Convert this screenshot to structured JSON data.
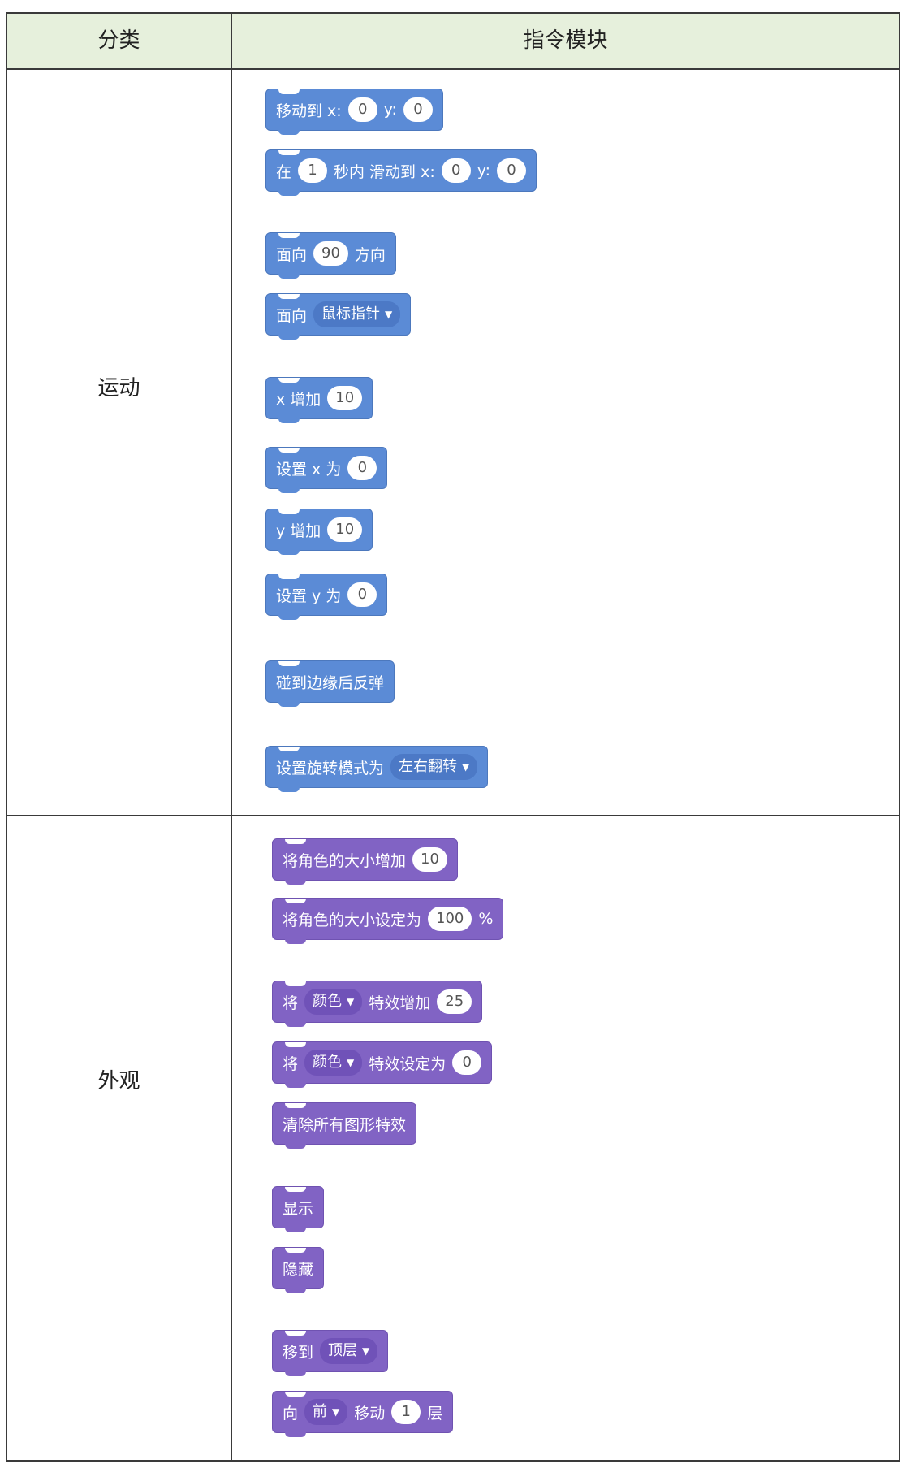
{
  "header": {
    "col1": "分类",
    "col2": "指令模块"
  },
  "categories": {
    "motion": "运动",
    "looks": "外观"
  },
  "blocks": {
    "goto_xy": {
      "t1": "移动到 x:",
      "x": "0",
      "t2": "y:",
      "y": "0"
    },
    "glide": {
      "t1": "在",
      "secs": "1",
      "t2": "秒内 滑动到 x:",
      "x": "0",
      "t3": "y:",
      "y": "0"
    },
    "point_dir": {
      "t1": "面向",
      "dir": "90",
      "t2": "方向"
    },
    "point_towards": {
      "t1": "面向",
      "target": "鼠标指针"
    },
    "change_x": {
      "t1": "x 增加",
      "v": "10"
    },
    "set_x": {
      "t1": "设置 x 为",
      "v": "0"
    },
    "change_y": {
      "t1": "y 增加",
      "v": "10"
    },
    "set_y": {
      "t1": "设置 y 为",
      "v": "0"
    },
    "bounce": {
      "t1": "碰到边缘后反弹"
    },
    "rotation_style": {
      "t1": "设置旋转模式为",
      "mode": "左右翻转"
    },
    "change_size": {
      "t1": "将角色的大小增加",
      "v": "10"
    },
    "set_size": {
      "t1": "将角色的大小设定为",
      "v": "100",
      "unit": "%"
    },
    "change_effect": {
      "t1": "将",
      "effect": "颜色",
      "t2": "特效增加",
      "v": "25"
    },
    "set_effect": {
      "t1": "将",
      "effect": "颜色",
      "t2": "特效设定为",
      "v": "0"
    },
    "clear_effects": {
      "t1": "清除所有图形特效"
    },
    "show": {
      "t1": "显示"
    },
    "hide": {
      "t1": "隐藏"
    },
    "goto_layer": {
      "t1": "移到",
      "layer": "顶层"
    },
    "move_layer": {
      "t1": "向",
      "dir": "前",
      "t2": "移动",
      "v": "1",
      "t3": "层"
    }
  },
  "colors": {
    "motion": "#5b8bd6",
    "looks": "#8163c4",
    "header_bg": "#e6f0dc"
  }
}
